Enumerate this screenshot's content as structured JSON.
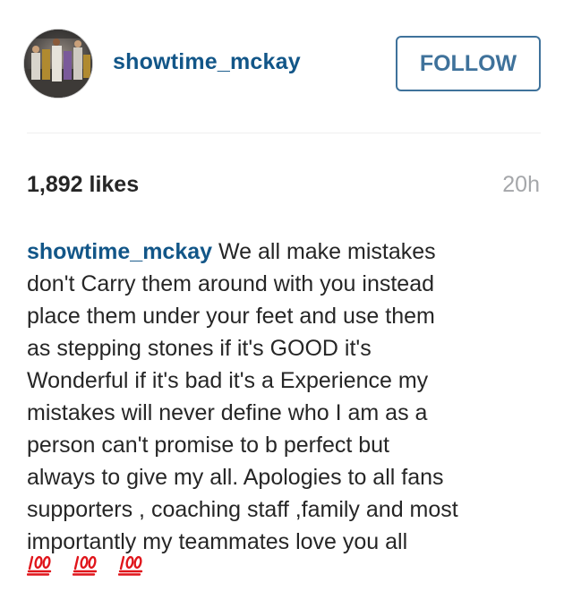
{
  "post": {
    "username": "showtime_mckay",
    "follow_label": "FOLLOW",
    "likes": "1,892 likes",
    "time_ago": "20h",
    "caption": {
      "username": "showtime_mckay",
      "text": " We all make mistakes\ndon't Carry them around with you instead\nplace them under your feet and use them\nas stepping stones if it's GOOD it's\nWonderful if it's bad it's a Experience my\nmistakes will never define who I am as a\nperson can't promise to b perfect but\nalways to give my all. Apologies to all fans\nsupporters , coaching staff ,family and most\nimportantly my teammates love you all",
      "emoji": [
        "hundred-points-icon",
        "hundred-points-icon",
        "hundred-points-icon"
      ]
    }
  },
  "colors": {
    "username": "#125688",
    "follow_border": "#3f729b",
    "text": "#262626",
    "muted": "#a5a7aa",
    "divider": "#efefef",
    "hundred_red": "#e0151b"
  }
}
